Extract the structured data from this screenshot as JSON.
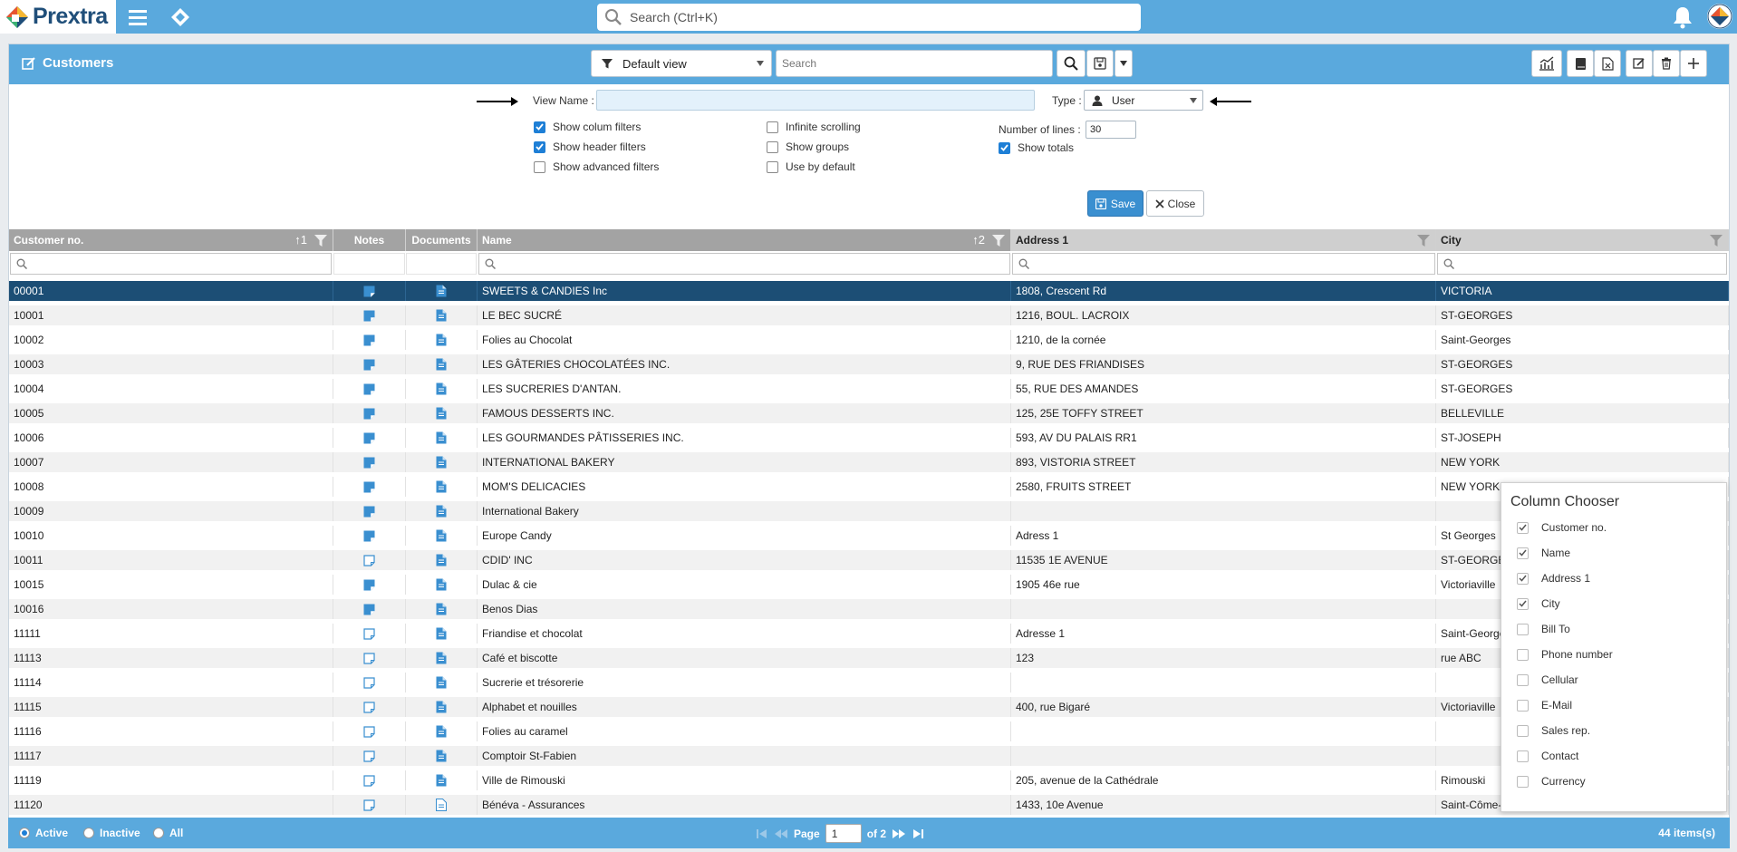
{
  "app": {
    "logo_text": "Prextra",
    "search_placeholder": "Search (Ctrl+K)"
  },
  "panel": {
    "title": "Customers",
    "view_select": "Default view",
    "search_placeholder": "Search"
  },
  "view_form": {
    "view_name_label": "View Name :",
    "view_name_value": "",
    "type_label": "Type :",
    "type_value": "User",
    "show_column_filters": "Show colum filters",
    "show_header_filters": "Show header filters",
    "show_advanced_filters": "Show advanced filters",
    "infinite_scrolling": "Infinite scrolling",
    "show_groups": "Show groups",
    "use_by_default": "Use by default",
    "number_of_lines_label": "Number of lines :",
    "number_of_lines_value": "30",
    "show_totals": "Show totals",
    "save_label": "Save",
    "close_label": "Close"
  },
  "columns": {
    "customer_no": "Customer no.",
    "customer_no_sort": "1",
    "notes": "Notes",
    "documents": "Documents",
    "name": "Name",
    "name_sort": "2",
    "address1": "Address 1",
    "city": "City"
  },
  "rows": [
    {
      "no": "00001",
      "name": "SWEETS & CANDIES Inc",
      "address": "1808, Crescent Rd",
      "city": "VICTORIA",
      "note": "filled"
    },
    {
      "no": "10001",
      "name": "LE BEC SUCRÉ",
      "address": "1216, BOUL. LACROIX",
      "city": "ST-GEORGES",
      "note": "filled"
    },
    {
      "no": "10002",
      "name": "Folies au Chocolat",
      "address": "1210, de la cornée",
      "city": "Saint-Georges",
      "note": "filled"
    },
    {
      "no": "10003",
      "name": "LES GÂTERIES CHOCOLATÉES INC.",
      "address": "9, RUE DES FRIANDISES",
      "city": "ST-GEORGES",
      "note": "filled"
    },
    {
      "no": "10004",
      "name": "LES SUCRERIES D'ANTAN.",
      "address": "55, RUE DES AMANDES",
      "city": "ST-GEORGES",
      "note": "filled"
    },
    {
      "no": "10005",
      "name": "FAMOUS DESSERTS INC.",
      "address": "125, 25E TOFFY STREET",
      "city": "BELLEVILLE",
      "note": "filled"
    },
    {
      "no": "10006",
      "name": "LES GOURMANDES PÂTISSERIES INC.",
      "address": "593, AV DU PALAIS RR1",
      "city": "ST-JOSEPH",
      "note": "filled"
    },
    {
      "no": "10007",
      "name": "INTERNATIONAL BAKERY",
      "address": "893, VISTORIA STREET",
      "city": "NEW YORK",
      "note": "filled"
    },
    {
      "no": "10008",
      "name": "MOM'S DELICACIES",
      "address": "2580, FRUITS STREET",
      "city": "NEW YORK",
      "note": "filled"
    },
    {
      "no": "10009",
      "name": "International Bakery",
      "address": "",
      "city": "",
      "note": "filled"
    },
    {
      "no": "10010",
      "name": "Europe Candy",
      "address": "Adress 1",
      "city": "St Georges",
      "note": "filled"
    },
    {
      "no": "10011",
      "name": "CDID' INC",
      "address": "11535 1E AVENUE",
      "city": "ST-GEORGES",
      "note": "empty"
    },
    {
      "no": "10015",
      "name": "Dulac & cie",
      "address": "1905 46e rue",
      "city": "Victoriaville",
      "note": "filled"
    },
    {
      "no": "10016",
      "name": "Benos Dias",
      "address": "",
      "city": "",
      "note": "filled"
    },
    {
      "no": "11111",
      "name": "Friandise et chocolat",
      "address": "Adresse 1",
      "city": "Saint-Georges",
      "note": "empty"
    },
    {
      "no": "11113",
      "name": "Café et biscotte",
      "address": "123",
      "city": "rue ABC",
      "note": "empty"
    },
    {
      "no": "11114",
      "name": "Sucrerie et trésorerie",
      "address": "",
      "city": "",
      "note": "empty"
    },
    {
      "no": "11115",
      "name": "Alphabet et nouilles",
      "address": "400, rue Bigaré",
      "city": "Victoriaville",
      "note": "empty"
    },
    {
      "no": "11116",
      "name": "Folies au caramel",
      "address": "",
      "city": "",
      "note": "empty"
    },
    {
      "no": "11117",
      "name": "Comptoir St-Fabien",
      "address": "",
      "city": "",
      "note": "empty"
    },
    {
      "no": "11119",
      "name": "Ville de Rimouski",
      "address": "205, avenue de la Cathédrale",
      "city": "Rimouski",
      "note": "empty"
    },
    {
      "no": "11120",
      "name": "Bénéva - Assurances",
      "address": "1433, 10e Avenue",
      "city": "Saint-Côme-",
      "note": "empty"
    }
  ],
  "column_chooser": {
    "title": "Column Chooser",
    "items": [
      {
        "label": "Customer no.",
        "checked": true
      },
      {
        "label": "Name",
        "checked": true
      },
      {
        "label": "Address 1",
        "checked": true
      },
      {
        "label": "City",
        "checked": true
      },
      {
        "label": "Bill To",
        "checked": false
      },
      {
        "label": "Phone number",
        "checked": false
      },
      {
        "label": "Cellular",
        "checked": false
      },
      {
        "label": "E-Mail",
        "checked": false
      },
      {
        "label": "Sales rep.",
        "checked": false
      },
      {
        "label": "Contact",
        "checked": false
      },
      {
        "label": "Currency",
        "checked": false
      }
    ]
  },
  "footer": {
    "active": "Active",
    "inactive": "Inactive",
    "all": "All",
    "page_label": "Page",
    "page_value": "1",
    "of_pages": "of 2",
    "count": "44 items(s)"
  },
  "colors": {
    "accent": "#5aa9dd",
    "selected_row": "#1c4e75",
    "icon_blue": "#3a8fd0"
  }
}
